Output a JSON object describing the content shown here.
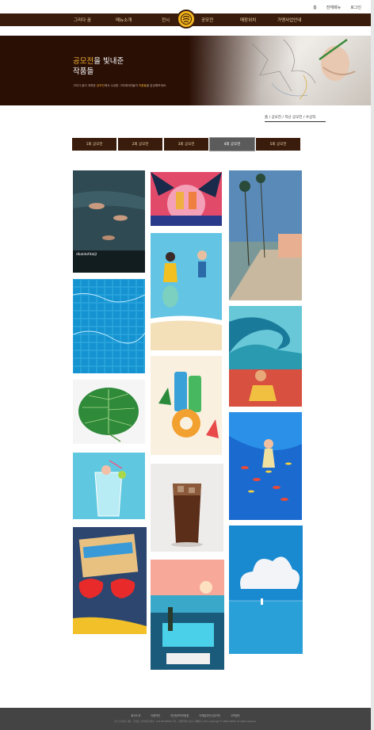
{
  "utility": {
    "home": "홈",
    "sitemap": "전체메뉴",
    "login": "로그인"
  },
  "nav": {
    "items": [
      "그리다 꿈",
      "메뉴소개",
      "전시",
      "공모전",
      "매장위치",
      "가맹사업안내"
    ]
  },
  "hero": {
    "title_accent": "공모전",
    "title_rest": "을 빛내준",
    "title_line2": "작품들",
    "desc_a": "그리다 꿈이 개최한 ",
    "desc_accent1": "공모전",
    "desc_b": "에서 수상한 그리에이터들의 ",
    "desc_accent2": "작품들",
    "desc_c": "을 감상해보세요."
  },
  "breadcrumb": {
    "text": "홈 / 공모전 / 지난 공모전 / 수상작"
  },
  "tabs": [
    "1회 공모전",
    "2회 공모전",
    "3회 공모전",
    "4회 공모전",
    "5회 공모전"
  ],
  "active_tab": "4회 공모전",
  "gallery": {
    "hover_caption": "dkaldofdaljl"
  },
  "colors": {
    "brand_dark": "#3a1c0c",
    "brand_gold": "#f2b41c",
    "accent": "#f0b030"
  },
  "footer": {
    "links": [
      "회사소개",
      "이용약관",
      "개인정보처리방침",
      "이메일무단수집거부",
      "고객센터"
    ],
    "info": "(주)그리다꿈 | 대표 : 홍길동 | 사업자등록번호 : 123-45-67890 | 주소 : 서울특별시 강남구 테헤란로 123 | Copyright © GRIDA KKUM. All rights reserved."
  }
}
